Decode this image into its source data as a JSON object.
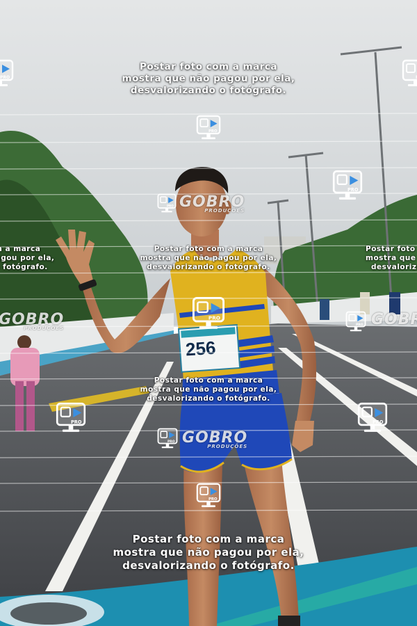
{
  "watermark": {
    "line1": "Postar foto com a marca",
    "line2": "mostra que não pagou por ela,",
    "line3": "desvalorizando o fotógrafo.",
    "brand": "GOBRO",
    "brand_sub": "PRODUÇÕES",
    "cam_badge": "PRO"
  },
  "runner": {
    "bib_number": "256"
  },
  "colors": {
    "sky": "#d8dcdf",
    "asphalt": "#4a4d52",
    "singlet_yellow": "#e0b21f",
    "shorts_blue": "#1f48b8",
    "mat_teal": "#1d8fb0"
  }
}
